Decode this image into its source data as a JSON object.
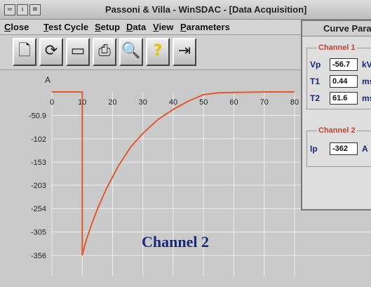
{
  "window": {
    "title": "Passoni & Villa - WinSDAC - [Data Acquisition]",
    "system_buttons": [
      "=",
      "ı",
      "≡"
    ]
  },
  "menu": [
    {
      "label": "Close"
    },
    {
      "label": "Test Cycle"
    },
    {
      "label": "Setup"
    },
    {
      "label": "Data"
    },
    {
      "label": "View"
    },
    {
      "label": "Parameters"
    }
  ],
  "toolbar": [
    {
      "icon": "open-file-icon",
      "glyph": "🗋"
    },
    {
      "icon": "refresh-icon",
      "glyph": "⟳"
    },
    {
      "icon": "tape-icon",
      "glyph": "▭"
    },
    {
      "icon": "printer-icon",
      "glyph": "⎙"
    },
    {
      "icon": "magnifier-icon",
      "glyph": "🔍"
    },
    {
      "icon": "help-icon",
      "glyph": "?"
    },
    {
      "icon": "exit-icon",
      "glyph": "⇥"
    }
  ],
  "panel": {
    "title": "Curve Parameters",
    "channel1": {
      "title": "Channel 1",
      "params": [
        {
          "label": "Vp",
          "value": "-56.7",
          "unit": "kV"
        },
        {
          "label": "T1",
          "value": "0.44",
          "unit": "ms"
        },
        {
          "label": "T2",
          "value": "61.6",
          "unit": "ms"
        }
      ]
    },
    "channel2": {
      "title": "Channel 2",
      "params": [
        {
          "label": "Ip",
          "value": "-362",
          "unit": "A"
        }
      ]
    }
  },
  "chart_data": {
    "type": "line",
    "ylabel": "A",
    "title": "Channel 2",
    "x_ticks": [
      "0",
      "10",
      "20",
      "30",
      "40",
      "50",
      "60",
      "70",
      "80"
    ],
    "y_ticks": [
      "-50.9",
      "-102",
      "-153",
      "-203",
      "-254",
      "-305",
      "-356"
    ],
    "xlim": [
      0,
      80
    ],
    "ylim": [
      -356,
      0
    ],
    "grid": true,
    "series": [
      {
        "color": "#e05a30",
        "x": [
          0,
          10,
          10,
          11,
          13,
          15,
          18,
          22,
          26,
          30,
          35,
          40,
          45,
          50,
          55,
          60,
          70,
          80
        ],
        "y": [
          0,
          0,
          -356,
          -330,
          -290,
          -255,
          -210,
          -160,
          -120,
          -90,
          -60,
          -38,
          -20,
          -6,
          -2,
          -1,
          0,
          0
        ]
      }
    ]
  },
  "colors": {
    "trace": "#e05a30",
    "label": "#1a2a78",
    "grid": "#eeeeee"
  }
}
